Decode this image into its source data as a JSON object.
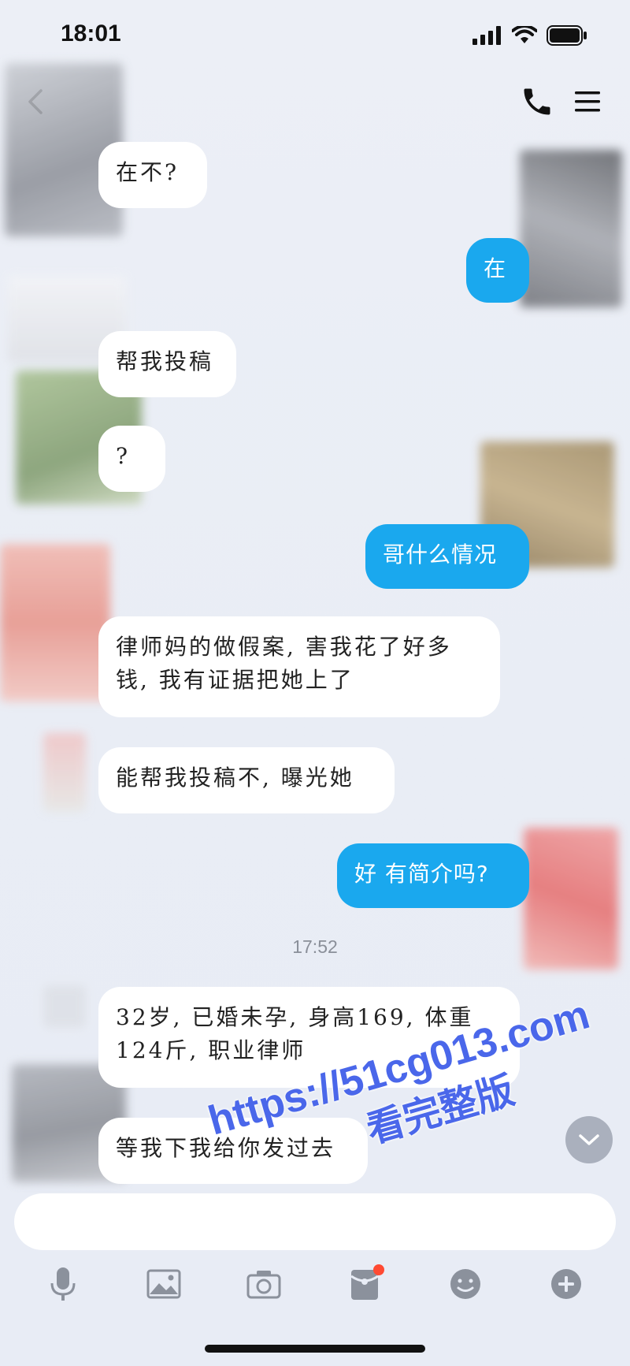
{
  "status": {
    "time": "18:01"
  },
  "messages": [
    {
      "side": "in",
      "text": "在不?"
    },
    {
      "side": "out",
      "text": "在"
    },
    {
      "side": "in",
      "text": "帮我投稿"
    },
    {
      "side": "in",
      "text": "?"
    },
    {
      "side": "out",
      "text": "哥什么情况"
    },
    {
      "side": "in",
      "text": "律师妈的做假案, 害我花了好多钱, 我有证据把她上了"
    },
    {
      "side": "in",
      "text": "能帮我投稿不, 曝光她"
    },
    {
      "side": "out",
      "text": "好 有简介吗?"
    },
    {
      "side": "in",
      "text": "32岁, 已婚未孕, 身高169, 体重124斤, 职业律师"
    },
    {
      "side": "in",
      "text": "等我下我给你发过去"
    }
  ],
  "timestamp": "17:52",
  "toolbar": [
    "mic-icon",
    "image-icon",
    "camera-icon",
    "red-packet-icon",
    "emoji-icon",
    "plus-icon"
  ],
  "watermark": {
    "line1": "https://51cg013.com",
    "line2": "看完整版"
  },
  "colors": {
    "accent": "#1aa8ee",
    "background": "#eceff6",
    "badge": "#ff4a33"
  }
}
